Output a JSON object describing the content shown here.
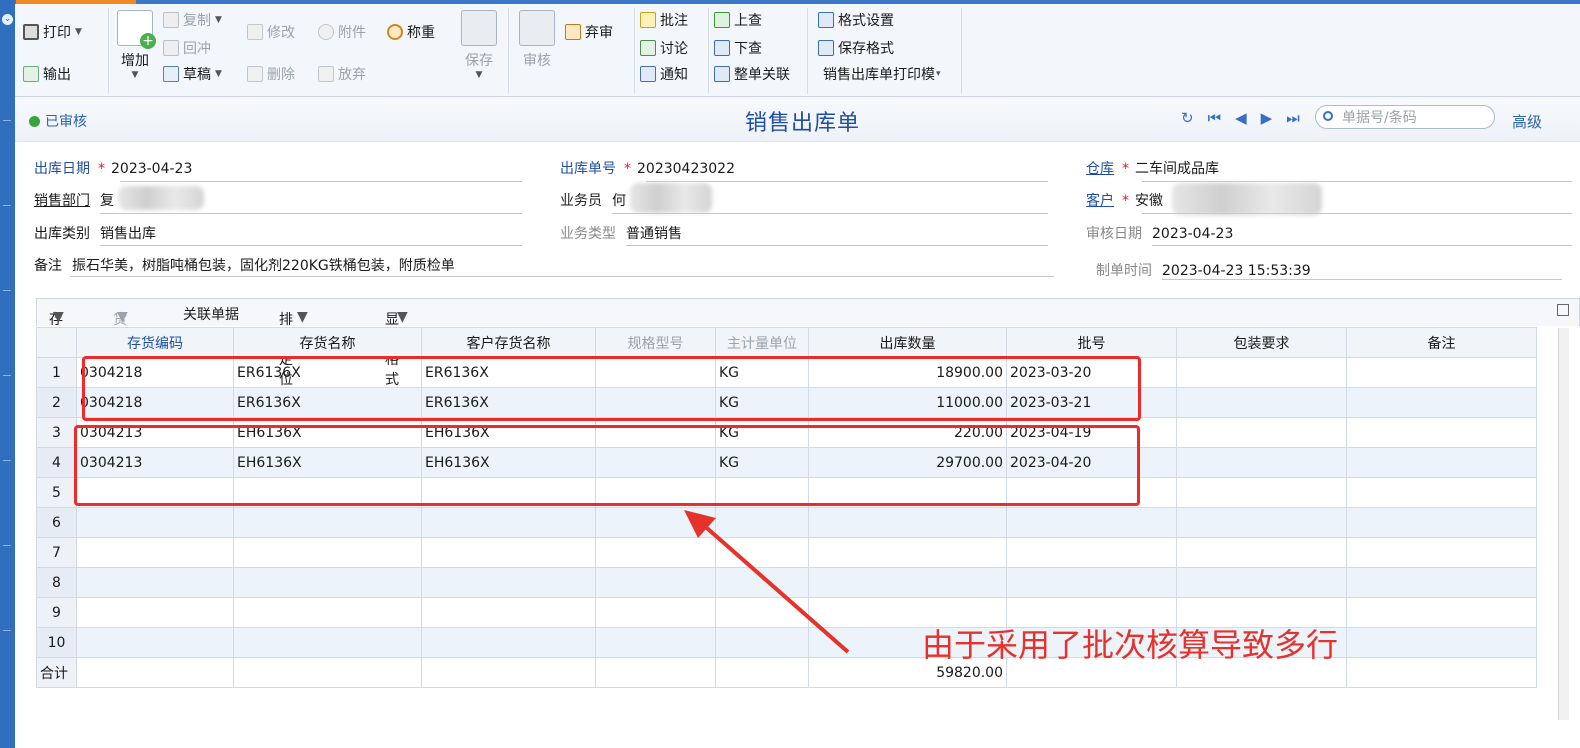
{
  "toolbar": {
    "print": "打印",
    "export": "输出",
    "add": "增加",
    "copy": "复制",
    "reverse": "回冲",
    "draft": "草稿",
    "modify": "修改",
    "delete": "删除",
    "attach": "附件",
    "abandon": "放弃",
    "weigh": "称重",
    "save": "保存",
    "audit": "审核",
    "unaudit": "弃审",
    "annotate": "批注",
    "discuss": "讨论",
    "notify": "通知",
    "prev_query": "上查",
    "next_query": "下查",
    "link_all": "整单关联",
    "format_settings": "格式设置",
    "save_format": "保存格式",
    "print_template": "销售出库单打印模"
  },
  "header": {
    "status": "已审核",
    "title": "销售出库单",
    "search_placeholder": "单据号/条码",
    "advanced": "高级"
  },
  "form": {
    "out_date_label": "出库日期",
    "out_date": "2023-04-23",
    "out_no_label": "出库单号",
    "out_no": "20230423022",
    "warehouse_label": "仓库",
    "warehouse": "二车间成品库",
    "dept_label": "销售部门",
    "dept_prefix": "复",
    "dept_suffix": "部",
    "salesman_label": "业务员",
    "salesman": "何",
    "customer_label": "客户",
    "customer": "安徽",
    "out_type_label": "出库类别",
    "out_type": "销售出库",
    "biz_type_label": "业务类型",
    "biz_type": "普通销售",
    "audit_date_label": "审核日期",
    "audit_date": "2023-04-23",
    "remark_label": "备注",
    "remark": "振石华美，树脂吨桶包装，固化剂220KG铁桶包装，附质检单",
    "create_time_label": "制单时间",
    "create_time": "2023-04-23 15:53:39"
  },
  "grid_toolbar": {
    "stock": "存量",
    "location": "货位",
    "related": "关联单据",
    "sort": "排序定位",
    "display": "显示格式"
  },
  "grid": {
    "columns": [
      "存货编码",
      "存货名称",
      "客户存货名称",
      "规格型号",
      "主计量单位",
      "出库数量",
      "批号",
      "包装要求",
      "备注"
    ],
    "rows": [
      {
        "no": "1",
        "code": "0304218",
        "name": "ER6136X",
        "cust_name": "ER6136X",
        "spec": "",
        "unit": "KG",
        "qty": "18900.00",
        "batch": "2023-03-20",
        "pack": "",
        "note": ""
      },
      {
        "no": "2",
        "code": "0304218",
        "name": "ER6136X",
        "cust_name": "ER6136X",
        "spec": "",
        "unit": "KG",
        "qty": "11000.00",
        "batch": "2023-03-21",
        "pack": "",
        "note": ""
      },
      {
        "no": "3",
        "code": "0304213",
        "name": "EH6136X",
        "cust_name": "EH6136X",
        "spec": "",
        "unit": "KG",
        "qty": "220.00",
        "batch": "2023-04-19",
        "pack": "",
        "note": ""
      },
      {
        "no": "4",
        "code": "0304213",
        "name": "EH6136X",
        "cust_name": "EH6136X",
        "spec": "",
        "unit": "KG",
        "qty": "29700.00",
        "batch": "2023-04-20",
        "pack": "",
        "note": ""
      },
      {
        "no": "5",
        "code": "",
        "name": "",
        "cust_name": "",
        "spec": "",
        "unit": "",
        "qty": "",
        "batch": "",
        "pack": "",
        "note": ""
      },
      {
        "no": "6",
        "code": "",
        "name": "",
        "cust_name": "",
        "spec": "",
        "unit": "",
        "qty": "",
        "batch": "",
        "pack": "",
        "note": ""
      },
      {
        "no": "7",
        "code": "",
        "name": "",
        "cust_name": "",
        "spec": "",
        "unit": "",
        "qty": "",
        "batch": "",
        "pack": "",
        "note": ""
      },
      {
        "no": "8",
        "code": "",
        "name": "",
        "cust_name": "",
        "spec": "",
        "unit": "",
        "qty": "",
        "batch": "",
        "pack": "",
        "note": ""
      },
      {
        "no": "9",
        "code": "",
        "name": "",
        "cust_name": "",
        "spec": "",
        "unit": "",
        "qty": "",
        "batch": "",
        "pack": "",
        "note": ""
      },
      {
        "no": "10",
        "code": "",
        "name": "",
        "cust_name": "",
        "spec": "",
        "unit": "",
        "qty": "",
        "batch": "",
        "pack": "",
        "note": ""
      }
    ],
    "total_label": "合计",
    "total_qty": "59820.00"
  },
  "annotation": {
    "text": "由于采用了批次核算导致多行",
    "color": "#e5322b"
  }
}
